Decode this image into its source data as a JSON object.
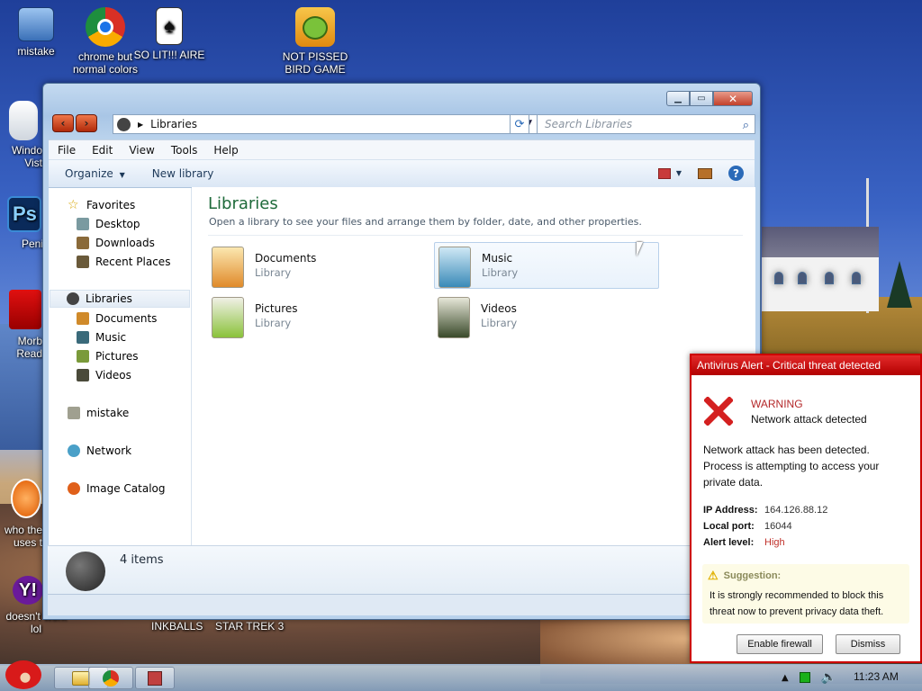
{
  "desktop": {
    "icons": [
      {
        "label": "mistake"
      },
      {
        "label": "chrome but normal colors"
      },
      {
        "label": "SO LIT!!! AIRE"
      },
      {
        "label": "NOT PISSED BIRD GAME"
      }
    ],
    "partial_labels": {
      "windows_vista": "Windo\nVist",
      "photoshop": "Peni",
      "reader": "Morb\nRead",
      "who_the": "who the\nuses t",
      "yahoo": "doesn't work\nlol",
      "inkballs": "INKBALLS",
      "star_trek": "STAR TREK 3"
    }
  },
  "explorer": {
    "address_label": "Libraries",
    "search_placeholder": "Search Libraries",
    "menu": [
      "File",
      "Edit",
      "View",
      "Tools",
      "Help"
    ],
    "toolbar": {
      "organize": "Organize",
      "new_library": "New library"
    },
    "nav": {
      "favorites": "Favorites",
      "favorites_items": [
        "Desktop",
        "Downloads",
        "Recent Places"
      ],
      "libraries": "Libraries",
      "libraries_items": [
        "Documents",
        "Music",
        "Pictures",
        "Videos"
      ],
      "mistake": "mistake",
      "network": "Network",
      "image_catalog": "Image Catalog"
    },
    "content": {
      "title": "Libraries",
      "subtitle": "Open a library to see your files and arrange them by folder, date, and other properties.",
      "tiles": [
        {
          "name": "Documents",
          "type": "Library"
        },
        {
          "name": "Music",
          "type": "Library"
        },
        {
          "name": "Pictures",
          "type": "Library"
        },
        {
          "name": "Videos",
          "type": "Library"
        }
      ]
    },
    "details": {
      "count": "4 items"
    }
  },
  "antivirus": {
    "title": "Antivirus Alert - Critical threat detected",
    "warning": "WARNING",
    "headline": "Network attack detected",
    "body": "Network attack has been detected. Process is attempting to access your private data.",
    "fields": [
      {
        "label": "IP Address:",
        "value": "164.126.88.12"
      },
      {
        "label": "Local port:",
        "value": "16044"
      },
      {
        "label": "Alert level:",
        "value": "High"
      }
    ],
    "suggestion_title": "Suggestion:",
    "suggestion_body": "It is strongly recommended to block this threat now to prevent privacy data theft.",
    "btn_enable": "Enable firewall",
    "btn_dismiss": "Dismiss"
  },
  "taskbar": {
    "clock": "11:23 AM"
  }
}
